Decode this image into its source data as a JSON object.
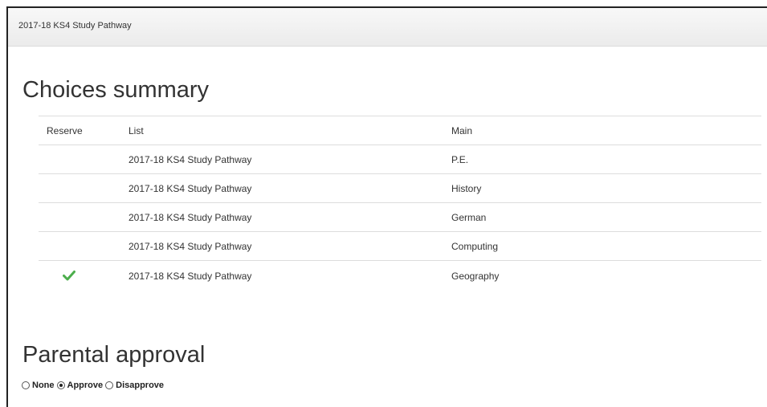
{
  "panel": {
    "title": "2017-18 KS4 Study Pathway"
  },
  "choices": {
    "heading": "Choices summary",
    "columns": {
      "reserve": "Reserve",
      "list": "List",
      "main": "Main"
    },
    "rows": [
      {
        "reserve": false,
        "list": "2017-18 KS4 Study Pathway",
        "main": "P.E."
      },
      {
        "reserve": false,
        "list": "2017-18 KS4 Study Pathway",
        "main": "History"
      },
      {
        "reserve": false,
        "list": "2017-18 KS4 Study Pathway",
        "main": "German"
      },
      {
        "reserve": false,
        "list": "2017-18 KS4 Study Pathway",
        "main": "Computing"
      },
      {
        "reserve": true,
        "list": "2017-18 KS4 Study Pathway",
        "main": "Geography"
      }
    ],
    "check_color": "#4cae4c"
  },
  "approval": {
    "heading": "Parental approval",
    "options": [
      {
        "label": "None",
        "selected": false
      },
      {
        "label": "Approve",
        "selected": true
      },
      {
        "label": "Disapprove",
        "selected": false
      }
    ]
  }
}
